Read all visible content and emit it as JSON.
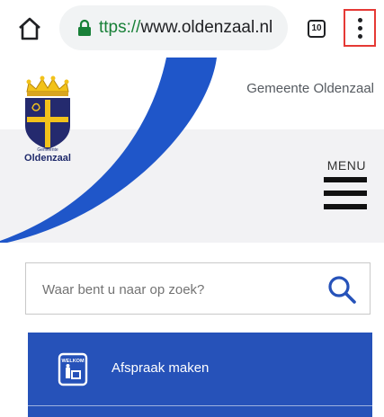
{
  "browser": {
    "url_scheme_fragment": "ttps://",
    "url_host": "www.oldenzaal.nl",
    "tab_count": "10",
    "icons": [
      "home-icon",
      "lock-icon",
      "tab-switcher-icon",
      "more-vert-icon"
    ]
  },
  "header": {
    "municipality_name": "Gemeente Oldenzaal",
    "logo_caption_small": "Gemeente",
    "logo_caption": "Oldenzaal",
    "menu_label": "MENU"
  },
  "search": {
    "placeholder": "Waar bent u naar op zoek?"
  },
  "tiles": [
    {
      "label": "Afspraak maken",
      "icon": "welcome-sign-icon",
      "icon_text": "WELKOM"
    }
  ],
  "colors": {
    "brand_blue": "#2652b9",
    "swoosh_blue": "#1f56c9",
    "secure_green": "#188038",
    "highlight_red": "#e53935"
  }
}
